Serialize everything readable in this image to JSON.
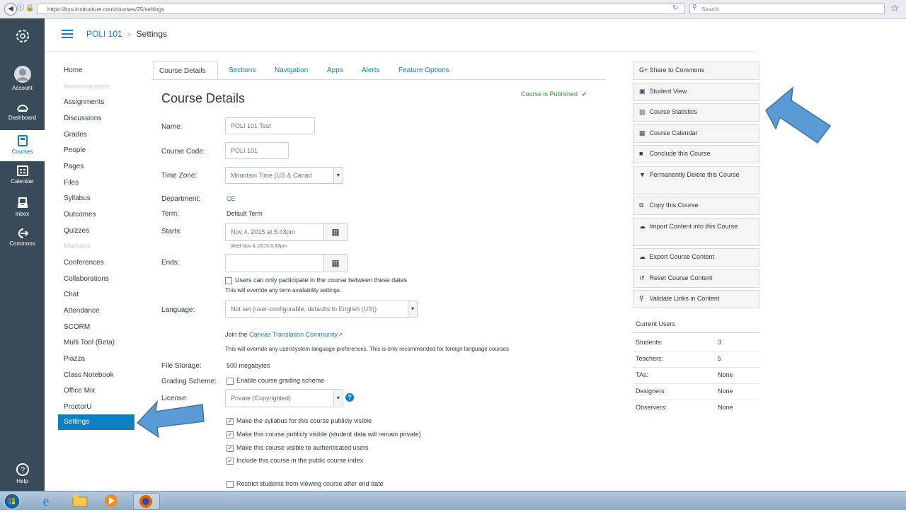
{
  "browser": {
    "url": "https://byu.instructure.com/courses/25/settings",
    "search_placeholder": "Search"
  },
  "global_nav": {
    "items": [
      {
        "label": "Account"
      },
      {
        "label": "Dashboard"
      },
      {
        "label": "Courses"
      },
      {
        "label": "Calendar"
      },
      {
        "label": "Inbox"
      },
      {
        "label": "Commons"
      },
      {
        "label": "Help"
      }
    ]
  },
  "header": {
    "course": "POLI 101",
    "separator": ">",
    "page": "Settings"
  },
  "course_nav": {
    "items": [
      "Home",
      "Announcements",
      "Assignments",
      "Discussions",
      "Grades",
      "People",
      "Pages",
      "Files",
      "Syllabus",
      "Outcomes",
      "Quizzes",
      "Modules",
      "Conferences",
      "Collaborations",
      "Chat",
      "Attendance",
      "SCORM",
      "Multi Tool (Beta)",
      "Piazza",
      "Class Notebook",
      "Office Mix",
      "ProctorU"
    ],
    "active": "Settings"
  },
  "tabs": [
    "Course Details",
    "Sections",
    "Navigation",
    "Apps",
    "Alerts",
    "Feature Options"
  ],
  "details": {
    "title": "Course Details",
    "published": "Course is Published",
    "name_label": "Name:",
    "name_value": "POLI 101 Test",
    "code_label": "Course Code:",
    "code_value": "POLI 101",
    "tz_label": "Time Zone:",
    "tz_value": "Mountain Time (US & Canad",
    "dept_label": "Department:",
    "dept_value": "CE",
    "term_label": "Term:",
    "term_value": "Default Term",
    "starts_label": "Starts:",
    "starts_value": "Nov 4, 2015 at  5:43pm",
    "starts_hint": "Wed Nov 4, 2015 8:43pm",
    "ends_label": "Ends:",
    "ends_value": "",
    "participate_text": "Users can only participate in the course between these dates",
    "participate_hint": "This will override any term availability settings.",
    "language_label": "Language:",
    "language_value": "Not set (user-configurable, defaults to English (US))",
    "join_prefix": "Join the ",
    "join_link": "Canvas Translation Community",
    "language_hint": "This will override any user/system language preferences. This is only recommended for foreign language courses",
    "storage_label": "File Storage:",
    "storage_value": "500 megabytes",
    "grading_label": "Grading Scheme:",
    "grading_text": "Enable course grading scheme",
    "license_label": "License:",
    "license_value": "Private (Copyrighted)",
    "vis_1": "Make the syllabus for this course publicly visible",
    "vis_2": "Make this course publicly visible (student data will remain private)",
    "vis_3": "Make this course visible to authenticated users",
    "vis_4": "Include this course in the public course index",
    "restrict_text": "Restrict students from viewing course after end date"
  },
  "sidebar": {
    "buttons": [
      {
        "icon": "G+",
        "label": "Share to Commons"
      },
      {
        "icon": "▣",
        "label": "Student View"
      },
      {
        "icon": "▥",
        "label": "Course Statistics"
      },
      {
        "icon": "▦",
        "label": "Course Calendar"
      },
      {
        "icon": "■",
        "label": "Conclude this Course"
      },
      {
        "icon": "▼",
        "label": "Permanently Delete this Course"
      },
      {
        "icon": "⧉",
        "label": "Copy this Course"
      },
      {
        "icon": "☁",
        "label": "Import Content into this Course"
      },
      {
        "icon": "☁",
        "label": "Export Course Content"
      },
      {
        "icon": "↺",
        "label": "Reset Course Content"
      },
      {
        "icon": "⚲",
        "label": "Validate Links in Content"
      }
    ],
    "users_title": "Current Users",
    "users": [
      {
        "role": "Students:",
        "count": "3"
      },
      {
        "role": "Teachers:",
        "count": "5"
      },
      {
        "role": "TAs:",
        "count": "None"
      },
      {
        "role": "Designers:",
        "count": "None"
      },
      {
        "role": "Observers:",
        "count": "None"
      }
    ]
  },
  "colors": {
    "nav_bg": "#394b58",
    "accent": "#0b81c3",
    "published": "#2ba02b",
    "arrow": "#5b9bd5"
  }
}
